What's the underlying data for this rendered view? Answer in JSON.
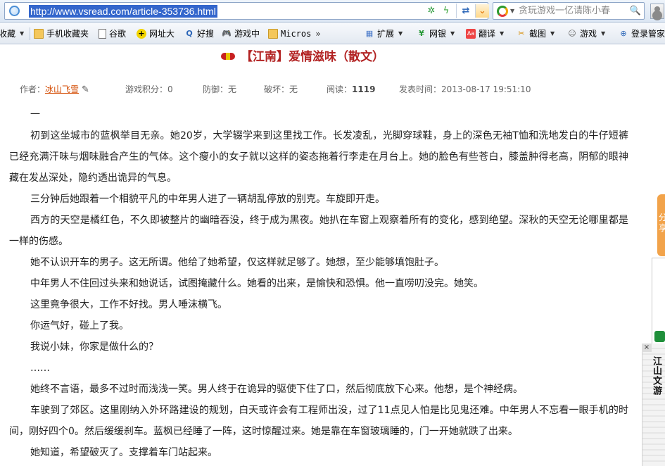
{
  "address_bar": {
    "url": "http://www.vsread.com/article-353736.html",
    "icons": {
      "page": "globe-icon",
      "refresh": "refresh-icon",
      "speed": "bolt-icon",
      "switch": "swap-icon",
      "dropdown": "dropdown-icon"
    },
    "refresh_glyph": "✲",
    "bolt_glyph": "ϟ",
    "swap_glyph": "⇄",
    "dropdown_glyph": "⌄"
  },
  "search": {
    "text": "贪玩游戏一亿请陈小春",
    "caret_glyph": "▼",
    "button_glyph": "🔍"
  },
  "favorites": [
    {
      "label": "收藏",
      "icon": "",
      "arrow": "▼"
    },
    {
      "label": "手机收藏夹",
      "icon": "folder-icon",
      "arrow": ""
    },
    {
      "label": "谷歌",
      "icon": "document-icon",
      "arrow": ""
    },
    {
      "label": "网址大",
      "icon": "plus-icon",
      "arrow": ""
    },
    {
      "label": "好搜",
      "icon": "search-icon",
      "arrow": ""
    },
    {
      "label": "游戏中",
      "icon": "game-icon",
      "arrow": ""
    },
    {
      "label": "Micros",
      "icon": "folder-icon",
      "arrow": "»"
    },
    {
      "label": "扩展",
      "icon": "grid-icon",
      "arrow": "▼"
    },
    {
      "label": "网银",
      "icon": "yen-icon",
      "arrow": "▼"
    },
    {
      "label": "翻译",
      "icon": "translate-icon",
      "arrow": "▼"
    },
    {
      "label": "截图",
      "icon": "scissors-icon",
      "arrow": "▼"
    },
    {
      "label": "游戏",
      "icon": "gamepad-icon",
      "arrow": "▼"
    },
    {
      "label": "登录管家",
      "icon": "login-icon",
      "arrow": ""
    }
  ],
  "article": {
    "title": "【江南】爱情滋味（散文）",
    "meta": {
      "author_label": "作者：",
      "author_name": "冰山飞雪",
      "score": "游戏积分：0",
      "defense": "防御：无",
      "damage": "破坏：无",
      "reads_label": "阅读：",
      "reads": "1119",
      "published": "发表时间：2013-08-17 19:51:10"
    },
    "paragraphs": [
      "一",
      "初到这坐城市的蓝枫举目无亲。她20岁，大学辍学来到这里找工作。长发凌乱，光脚穿球鞋，身上的深色无袖T恤和洗地发白的牛仔短裤已经充满汗味与烟味融合产生的气体。这个瘦小的女子就以这样的姿态拖着行李走在月台上。她的脸色有些苍白，膝盖肿得老高，阴郁的眼神藏在发丛深处，隐约透出诡异的气息。",
      "三分钟后她跟着一个相貌平凡的中年男人进了一辆胡乱停放的别克。车旋即开走。",
      "西方的天空是橘红色，不久即被整片的幽暗吞没，终于成为黑夜。她扒在车窗上观察着所有的变化，感到绝望。深秋的天空无论哪里都是一样的伤感。",
      "她不认识开车的男子。这无所谓。他给了她希望，仅这样就足够了。她想，至少能够填饱肚子。",
      "中年男人不住回过头来和她说话，试图掩藏什么。她看的出来，是愉快和恐惧。他一直唠叨没完。她笑。",
      "这里竟争很大，工作不好找。男人唾沫横飞。",
      "你运气好，碰上了我。",
      "我说小妹，你家是做什么的？",
      "……",
      "她终不言语，最多不过时而浅浅一笑。男人终于在诡异的驱使下住了口，然后彻底放下心来。他想，是个神经病。",
      "车驶到了郊区。这里刚纳入外环路建设的规划，白天或许会有工程师出没，过了11点见人怕是比见鬼还难。中年男人不忘看一眼手机的时间，刚好四个0。然后缓缓刹车。蓝枫已经睡了一阵，这时惊醒过来。她是靠在车窗玻璃睡的，门一开她就跌了出来。",
      "她知道，希望破灭了。支撑着车门站起来。"
    ]
  },
  "sidebar": {
    "orange_tab_text": "分享",
    "close_glyph": "×",
    "vertical_text": "江山文游"
  }
}
